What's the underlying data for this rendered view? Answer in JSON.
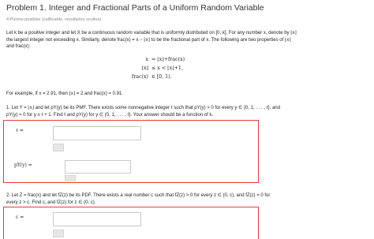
{
  "header": {
    "title": "Problem 1. Integer and Fractional Parts of a Uniform Random Variable",
    "points": "4 Puntos posibles (calificable, resultados ocultos)"
  },
  "intro": {
    "line1": "Let k be a positive integer and let X be a continuous random variable that is uniformly distributed on [0, k]. For any number x, denote by ⌊x⌋",
    "line2": "the largest integer not exceeding x. Similarly, denote frac(x) = x − ⌊x⌋ to be the fractional part of x. The following are two properties of ⌊x⌋",
    "line3": "and frac(x):"
  },
  "equations": {
    "eq1_lhs": "x",
    "eq1_rhs": "=  ⌊x⌋+frac(x)",
    "eq2_lhs": "⌊x⌋",
    "eq2_rhs": "≤  x < ⌊x⌋+1,",
    "eq3_lhs": "frac(x)",
    "eq3_rhs": "∈  [0, 1)."
  },
  "example": "For example, if x = 2.91, then ⌊x⌋ = 2 and frac(x) = 0.91.",
  "q1": {
    "line1": "1. Let Y = ⌊x⌋ and let pY(y) be its PMF. There exists some nonnegative integer ℓ such that pY(y) > 0 for every y ∈ {0, 1, . . . , ℓ}, and",
    "line2": "pY(y) = 0 for y ≥ ℓ + 1. Find ℓ and pY(y) for y ∈ {0, 1, . . . , ℓ}. Your answer should be a function of k.",
    "label_l": "ℓ =",
    "label_p": "pY(y) ="
  },
  "q2": {
    "line1": "2. Let Z = frac(x) and let fZ(z) be its PDF. There exists a real number c such that fZ(z) > 0 for every z ∈ (0, c), and fZ(z) = 0 for",
    "line2": "every z > c. Find c, and fZ(z) for z ∈ (0, c).",
    "label_c": "c ="
  }
}
